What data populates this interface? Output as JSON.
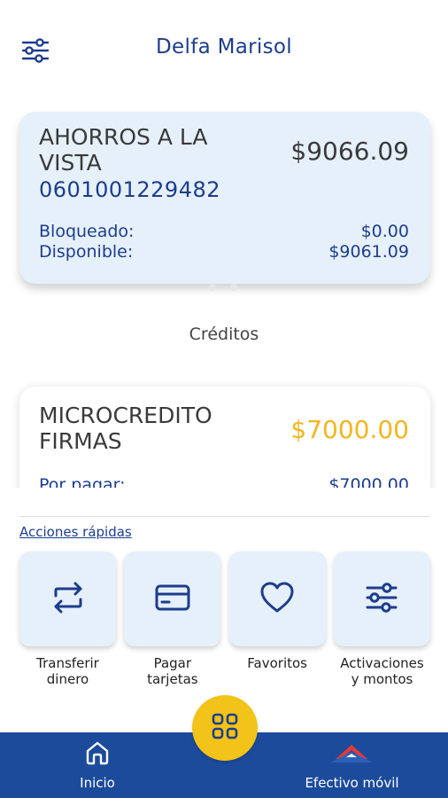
{
  "header": {
    "title": "Delfa Marisol",
    "filter_icon": "sliders-icon"
  },
  "account": {
    "name": "AHORROS A LA VISTA",
    "amount": "$9066.09",
    "number": "0601001229482",
    "blocked_label": "Bloqueado:",
    "blocked_value": "$0.00",
    "available_label": "Disponible:",
    "available_value": "$9061.09"
  },
  "carousel": {
    "pages": 2,
    "active": 0
  },
  "credits": {
    "section_title": "Créditos",
    "name": "MICROCREDITO FIRMAS",
    "amount": "$7000.00",
    "pending_label": "Por pagar:",
    "pending_value": "$7000.00"
  },
  "quick_actions": {
    "link_label": "Acciones rápidas",
    "items": [
      {
        "label": "Transferir\ndinero",
        "icon": "transfer-arrows-icon"
      },
      {
        "label": "Pagar\ntarjetas",
        "icon": "credit-card-icon"
      },
      {
        "label": "Favoritos",
        "icon": "heart-icon"
      },
      {
        "label": "Activaciones\ny montos",
        "icon": "sliders-icon"
      }
    ]
  },
  "bottom_nav": {
    "home_label": "Inicio",
    "cash_label": "Efectivo móvil",
    "fab_icon": "grid-icon"
  },
  "colors": {
    "brand_blue": "#1d3d8c",
    "nav_blue": "#1d4b9c",
    "card_bg": "#e6f0fb",
    "accent_yellow": "#f2c318",
    "credit_amount": "#f2b61f"
  }
}
